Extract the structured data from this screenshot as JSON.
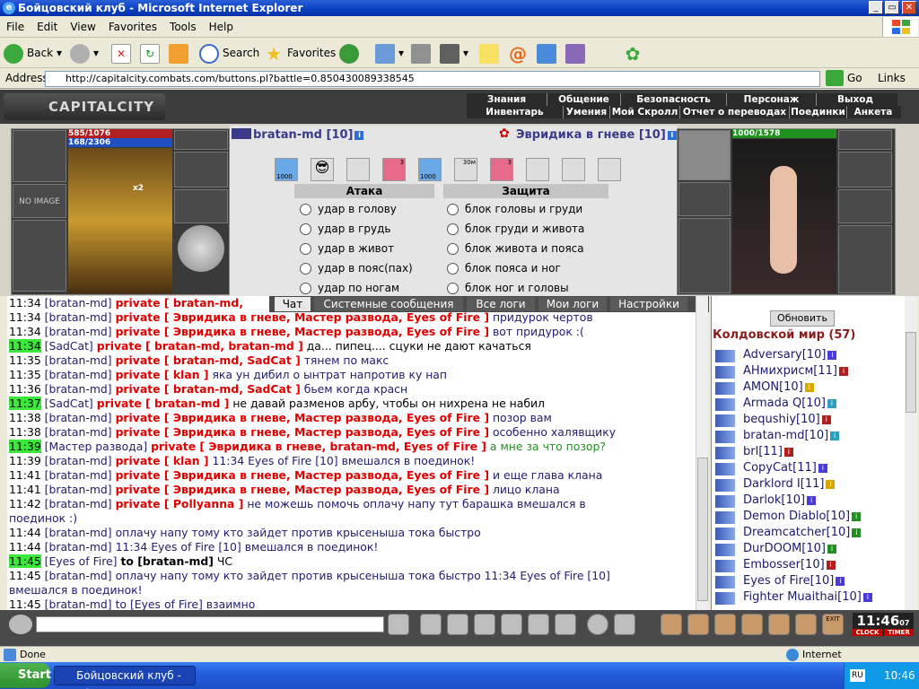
{
  "window": {
    "title": "Бойцовский клуб - Microsoft Internet Explorer",
    "minimize": "_",
    "maximize": "▭",
    "close": "✕"
  },
  "menu": [
    "File",
    "Edit",
    "View",
    "Favorites",
    "Tools",
    "Help"
  ],
  "toolbar": {
    "back": "Back",
    "search": "Search",
    "favorites": "Favorites"
  },
  "address": {
    "label": "Address",
    "url": "http://capitalcity.combats.com/buttons.pl?battle=0.850430089338545",
    "go": "Go",
    "links": "Links"
  },
  "game": {
    "logo": "CAPITALCITY",
    "nav_top": [
      "Знания",
      "Общение",
      "Безопасность",
      "Персонаж",
      "Выход"
    ],
    "nav_bottom": [
      "Инвентарь",
      "Умения",
      "Мой Скролл",
      "Отчет о переводах",
      "Поединки",
      "Анкета"
    ],
    "player": {
      "name": "bratan-md [10]",
      "hp": "585/1076",
      "mana": "168/2306",
      "no_image": "NO IMAGE",
      "x2": "x2"
    },
    "enemy": {
      "name": "Эвридика в гневе [10]",
      "hp": "1000/1578"
    },
    "effects": [
      "1000",
      "3",
      "1000",
      "30м",
      "3"
    ],
    "attack_head": "Атака",
    "defense_head": "Защита",
    "attacks": [
      "удар в голову",
      "удар в грудь",
      "удар в живот",
      "удар в пояс(пах)",
      "удар по ногам"
    ],
    "defenses": [
      "блок головы и груди",
      "блок груди и живота",
      "блок живота и пояса",
      "блок пояса и ног",
      "блок ног и головы"
    ]
  },
  "chat": {
    "tabs": [
      "Чат",
      "Системные сообщения",
      "Все логи",
      "Мои логи",
      "Настройки"
    ],
    "lines": [
      {
        "t": "11:34",
        "hl": false,
        "nick": "[bratan-md]",
        "priv": "private [ bratan-md,",
        "msg": ""
      },
      {
        "t": "11:34",
        "hl": false,
        "nick": "[bratan-md]",
        "priv": "private [ Эвридика в гневе, Мастер развода, Eyes of Fire ]",
        "msg": "придурок чертов"
      },
      {
        "t": "11:34",
        "hl": false,
        "nick": "[bratan-md]",
        "priv": "private [ Эвридика в гневе, Мастер развода, Eyes of Fire ]",
        "msg": "вот придурок :("
      },
      {
        "t": "11:34",
        "hl": true,
        "nick": "[SadCat]",
        "priv": "private [ bratan-md, bratan-md ]",
        "msg": "да... пипец.... сцуки не дают качаться",
        "dark": true
      },
      {
        "t": "11:35",
        "hl": false,
        "nick": "[bratan-md]",
        "priv": "private [ bratan-md, SadCat ]",
        "msg": "тянем по макс"
      },
      {
        "t": "11:35",
        "hl": false,
        "nick": "[bratan-md]",
        "priv": "private [ klan ]",
        "msg": "яка ун дибил о ынтрат напротив ку нап"
      },
      {
        "t": "11:36",
        "hl": false,
        "nick": "[bratan-md]",
        "priv": "private [ bratan-md, SadCat ]",
        "msg": "бьем когда красн"
      },
      {
        "t": "11:37",
        "hl": true,
        "nick": "[SadCat]",
        "priv": "private [ bratan-md ]",
        "msg": "не давай разменов арбу, чтобы он нихрена не набил",
        "dark": true
      },
      {
        "t": "11:38",
        "hl": false,
        "nick": "[bratan-md]",
        "priv": "private [ Эвридика в гневе, Мастер развода, Eyes of Fire ]",
        "msg": "позор вам"
      },
      {
        "t": "11:38",
        "hl": false,
        "nick": "[bratan-md]",
        "priv": "private [ Эвридика в гневе, Мастер развода, Eyes of Fire ]",
        "msg": "особенно халявщику"
      },
      {
        "t": "11:39",
        "hl": true,
        "nick": "[Мастер развода]",
        "priv": "private [ Эвридика в гневе, bratan-md, Eyes of Fire ]",
        "msg": "а мне за что позор?",
        "green": true
      },
      {
        "t": "11:39",
        "hl": false,
        "nick": "[bratan-md]",
        "priv": "private [ klan ]",
        "msg": "11:34 Eyes of Fire [10] вмешался в поединок!"
      },
      {
        "t": "11:41",
        "hl": false,
        "nick": "[bratan-md]",
        "priv": "private [ Эвридика в гневе, Мастер развода, Eyes of Fire ]",
        "msg": "и еще глава клана"
      },
      {
        "t": "11:41",
        "hl": false,
        "nick": "[bratan-md]",
        "priv": "private [ Эвридика в гневе, Мастер развода, Eyes of Fire ]",
        "msg": "лицо клана"
      },
      {
        "t": "11:42",
        "hl": false,
        "nick": "[bratan-md]",
        "priv": "private [ Pollyanna ]",
        "msg": "не можешь помочь оплачу напу тут барашка вмешался в"
      },
      {
        "t": "",
        "hl": false,
        "nick": "",
        "priv": "",
        "msg": "поединок :)"
      },
      {
        "t": "11:44",
        "hl": false,
        "nick": "[bratan-md]",
        "priv": "",
        "msg": "оплачу напу тому кто зайдет против крысеныша тока быстро"
      },
      {
        "t": "11:44",
        "hl": false,
        "nick": "[bratan-md]",
        "priv": "",
        "msg": "11:34 Eyes of Fire [10] вмешался в поединок!"
      },
      {
        "t": "11:45",
        "hl": true,
        "nick": "[Eyes of Fire]",
        "priv": "",
        "to": "to [bratan-md]",
        "msg": "ЧС",
        "dark": true
      },
      {
        "t": "11:45",
        "hl": false,
        "nick": "[bratan-md]",
        "priv": "",
        "msg": "оплачу напу тому кто зайдет против крысеныша тока быстро 11:34 Eyes of Fire [10]"
      },
      {
        "t": "",
        "hl": false,
        "nick": "",
        "priv": "",
        "msg": "вмешался в поединок!"
      },
      {
        "t": "11:45",
        "hl": false,
        "nick": "[bratan-md]",
        "priv": "",
        "msg": "to [Eyes of Fire] взаимно"
      }
    ]
  },
  "sidebar": {
    "refresh": "Обновить",
    "room": "Колдовской мир (57)",
    "users": [
      {
        "name": "Adversary[10]",
        "badge": "#4a3ad8"
      },
      {
        "name": "AHмихрисм[11]",
        "badge": "#b02020"
      },
      {
        "name": "AMON[10]",
        "badge": "#d8a800"
      },
      {
        "name": "Armada Q[10]",
        "badge": "#2aa0c0"
      },
      {
        "name": "bequshiy[10]",
        "badge": "#b02020"
      },
      {
        "name": "bratan-md[10]",
        "badge": "#2aa0c0"
      },
      {
        "name": "brl[11]",
        "badge": "#b02020"
      },
      {
        "name": "CopyCat[11]",
        "badge": "#4a3ad8"
      },
      {
        "name": "Darklord I[11]",
        "badge": "#d8a800"
      },
      {
        "name": "Darlok[10]",
        "badge": "#4a3ad8"
      },
      {
        "name": "Demon Diablo[10]",
        "badge": "#209020"
      },
      {
        "name": "Dreamcatcher[10]",
        "badge": "#209020"
      },
      {
        "name": "DurDOOM[10]",
        "badge": "#209020"
      },
      {
        "name": "Embosser[10]",
        "badge": "#b02020"
      },
      {
        "name": "Eyes of Fire[10]",
        "badge": "#4a3ad8"
      },
      {
        "name": "Fighter Muaithai[10]",
        "badge": "#4a3ad8"
      }
    ]
  },
  "bottom": {
    "clock": "11:46",
    "clock_sec": "07",
    "clock_label": "CLOCK",
    "timer_label": "TIMER",
    "exit": "EXIT"
  },
  "status": {
    "text": "Done",
    "zone": "Internet"
  },
  "taskbar": {
    "start": "Start",
    "item": "Бойцовский клуб - Mi...",
    "lang": "RU",
    "time": "10:46"
  }
}
